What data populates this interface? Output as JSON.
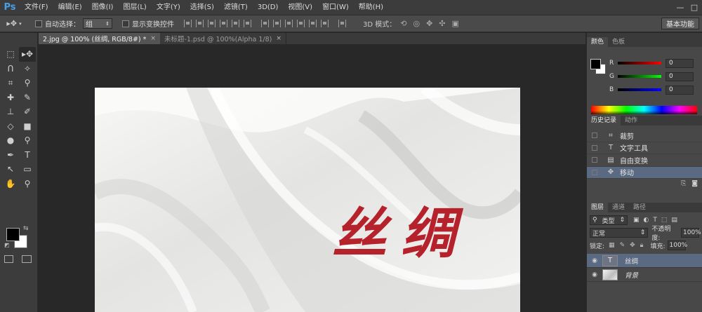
{
  "app": {
    "logo": "Ps"
  },
  "menu": [
    "文件(F)",
    "编辑(E)",
    "图像(I)",
    "图层(L)",
    "文字(Y)",
    "选择(S)",
    "滤镜(T)",
    "3D(D)",
    "视图(V)",
    "窗口(W)",
    "帮助(H)"
  ],
  "options": {
    "auto_select_label": "自动选择：",
    "auto_select_value": "组",
    "show_transform_label": "显示变换控件",
    "mode3d_label": "3D 模式：",
    "workspace_button": "基本功能"
  },
  "document_tabs": [
    {
      "label": "2.jpg @ 100% (丝绸, RGB/8#) *",
      "close": "×"
    },
    {
      "label": "未标题-1.psd @ 100%(Alpha 1/8)",
      "close": "×"
    }
  ],
  "canvas": {
    "text": "丝绸",
    "text_color": "#b5222b"
  },
  "color_panel": {
    "tabs": [
      "颜色",
      "色板"
    ],
    "sliders": [
      {
        "label": "R",
        "value": "0",
        "color": "#ff0000"
      },
      {
        "label": "G",
        "value": "0",
        "color": "#00ff00"
      },
      {
        "label": "B",
        "value": "0",
        "color": "#0000ff"
      }
    ]
  },
  "history_panel": {
    "tabs": [
      "历史记录",
      "动作"
    ],
    "items": [
      {
        "icon": "⌗",
        "label": "裁剪"
      },
      {
        "icon": "T",
        "label": "文字工具"
      },
      {
        "icon": "▤",
        "label": "自由变换"
      },
      {
        "icon": "✥",
        "label": "移动"
      }
    ]
  },
  "layers_panel": {
    "tabs": [
      "图层",
      "通道",
      "路径"
    ],
    "filter_kind": "类型",
    "blend_mode": "正常",
    "opacity_label": "不透明度:",
    "opacity_value": "100%",
    "lock_label": "锁定:",
    "fill_label": "填充:",
    "fill_value": "100%",
    "layers": [
      {
        "name": "丝绸",
        "type": "text",
        "thumb": "T"
      },
      {
        "name": "背景",
        "type": "image",
        "thumb": ""
      }
    ]
  }
}
